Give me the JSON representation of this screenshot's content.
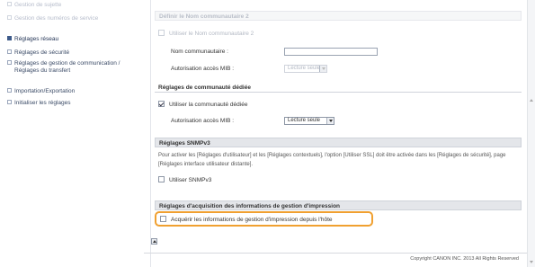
{
  "sidebar": {
    "items": [
      {
        "label": "Gestion de sujette",
        "state": "faded"
      },
      {
        "label": "Gestion des numéros de service",
        "state": "faded"
      },
      {
        "label": "Réglages réseau",
        "state": "active"
      },
      {
        "label": "Réglages de sécurité",
        "state": "normal"
      },
      {
        "label": "Réglages de gestion de communication / Réglages du transfert",
        "state": "normal"
      },
      {
        "label": "Importation/Exportation",
        "state": "normal"
      },
      {
        "label": "Initialiser les réglages",
        "state": "normal"
      }
    ]
  },
  "main": {
    "community2": {
      "header": "Définir le Nom communautaire 2",
      "checkbox_label": "Utiliser le Nom communautaire 2",
      "name_label": "Nom communautaire :",
      "name_value": "",
      "mib_label": "Autorisation accès MIB :",
      "mib_value": "Lecture seule"
    },
    "dedicated": {
      "header": "Réglages de communauté dédiée",
      "checkbox_label": "Utiliser la communauté dédiée",
      "checked": true,
      "mib_label": "Autorisation accès MIB :",
      "mib_value": "Lecture seule"
    },
    "snmpv3": {
      "header": "Réglages SNMPv3",
      "paragraph": "Pour activer les [Réglages d'utilisateur] et les [Réglages contextuels], l'option [Utiliser SSL] doit être activée dans les [Réglages de sécurité], page [Réglages interface utilisateur distante].",
      "checkbox_label": "Utiliser SNMPv3"
    },
    "print_mgmt": {
      "header": "Réglages d'acquisition des informations de gestion d'impression",
      "checkbox_label": "Acquérir les informations de gestion d'impression depuis l'hôte"
    }
  },
  "footer": {
    "copyright": "Copyright CANON INC. 2013 All Rights Reserved"
  },
  "colors": {
    "highlight": "#f0a030",
    "section_bg": "#e4e6ea",
    "sidebar_text": "#3a4a66"
  }
}
